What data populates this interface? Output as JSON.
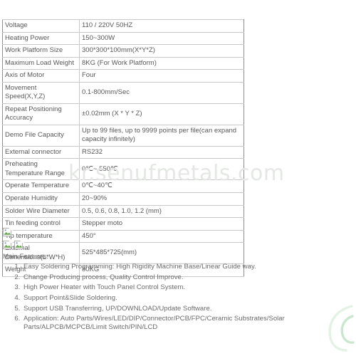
{
  "watermark": {
    "text": "kr.senufmetals.com",
    "color": "#e4e7e4",
    "leaf_icon": "leaf-icon"
  },
  "spec_table": {
    "rows": [
      {
        "key": "Voltage",
        "value": "110 / 220V 50HZ"
      },
      {
        "key": "Heating Power",
        "value": "150~300W"
      },
      {
        "key": "Work Platform Size",
        "value": "300*300*100mm(X*Y*Z)"
      },
      {
        "key": "Maximum Load Weight",
        "value": "8KG (For Work Platform)"
      },
      {
        "key": "Axis of Motor",
        "value": "Four"
      },
      {
        "key": "Movement Speed(X,Y,Z)",
        "value": "0.1-800mm/Sec"
      },
      {
        "key": "Repeat Positioning Accuracy",
        "value": "±0.02mm (X * Y * Z)"
      },
      {
        "key": "Demo File Capacity",
        "value": "Up to 99 files, up to 9999 points per file(can expand capacity infinitely)"
      },
      {
        "key": "External connector",
        "value": "RS232"
      },
      {
        "key": "Preheating Temperature Range",
        "value": "0℃~ 550℃"
      },
      {
        "key": "Operate Temperature",
        "value": "0℃~40℃"
      },
      {
        "key": "Operate Humidity",
        "value": "20~90%"
      },
      {
        "key": "Solder Wire Diameter",
        "value": "0.5, 0.6, 0.8, 1.0, 1.2 (mm)"
      },
      {
        "key": "Tin feeding control",
        "value": "Stepper moto"
      },
      {
        "key": "Tip temperature",
        "value": "450°"
      },
      {
        "key": "External Dimensions(L*W*H)",
        "value": "525*485*725(mm)"
      },
      {
        "key": "Weight",
        "value": "80KG"
      }
    ]
  },
  "broken_images": {
    "icon_name": "broken-image-icon",
    "rows": [
      [
        "broken-image-1"
      ],
      [
        "broken-image-2",
        "broken-image-3"
      ]
    ]
  },
  "features": {
    "title": "Main Features:",
    "items": [
      "Easy Soldering Programming: High Rigidity Machine Base/Linear Guide way.",
      "Change Producing process, Quality Control Improve.",
      "High Power Heater with Touch Panel Control System.",
      "Support Point&Slide Soldering.",
      "Support USB Transferring, UP/DOWNLOAD/Update Software.",
      "Application: Auto Parts/Wires/LED/DIP/Connector/PCB/FPC/Ceramic Substrates/Solar Parts/ALPCB/MCPCB/Limit Switch/PIN/LCD"
    ]
  }
}
